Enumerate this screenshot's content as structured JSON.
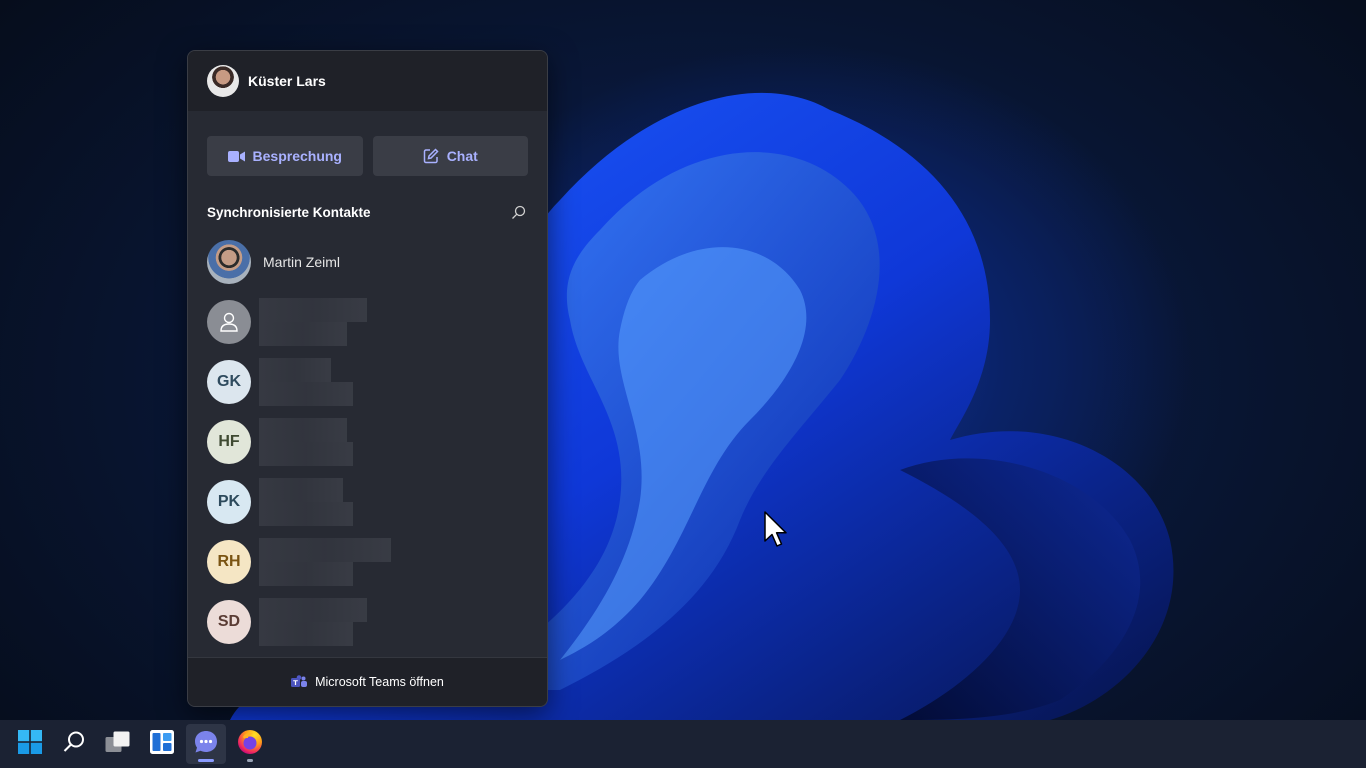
{
  "flyout": {
    "user_name": "Küster Lars",
    "meeting_label": "Besprechung",
    "chat_label": "Chat",
    "contacts_title": "Synchronisierte Kontakte",
    "contacts": [
      {
        "initials": "",
        "name": "Martin Zeiml",
        "type": "photo"
      },
      {
        "initials": "",
        "name": "",
        "type": "generic",
        "avatar_bg": "#8a8d94"
      },
      {
        "initials": "GK",
        "name": "",
        "type": "initials",
        "avatar_bg": "#dce6ee",
        "avatar_fg": "#2f4b5e"
      },
      {
        "initials": "HF",
        "name": "",
        "type": "initials",
        "avatar_bg": "#e1e6d9",
        "avatar_fg": "#3f4a32"
      },
      {
        "initials": "PK",
        "name": "",
        "type": "initials",
        "avatar_bg": "#d8e8f2",
        "avatar_fg": "#2d4a5c"
      },
      {
        "initials": "RH",
        "name": "",
        "type": "initials",
        "avatar_bg": "#f5e6c4",
        "avatar_fg": "#7a5412"
      },
      {
        "initials": "SD",
        "name": "",
        "type": "initials",
        "avatar_bg": "#ecdcd8",
        "avatar_fg": "#5a3c34"
      }
    ],
    "footer_label": "Microsoft Teams öffnen"
  },
  "taskbar": {
    "items": [
      {
        "icon": "windows-start-icon"
      },
      {
        "icon": "search-icon"
      },
      {
        "icon": "task-view-icon"
      },
      {
        "icon": "widgets-icon"
      },
      {
        "icon": "chat-icon",
        "active": true
      },
      {
        "icon": "firefox-icon"
      }
    ]
  },
  "colors": {
    "accent": "#a9b1ff",
    "flyout_bg": "#272a33",
    "taskbar_bg": "#1b2233"
  }
}
